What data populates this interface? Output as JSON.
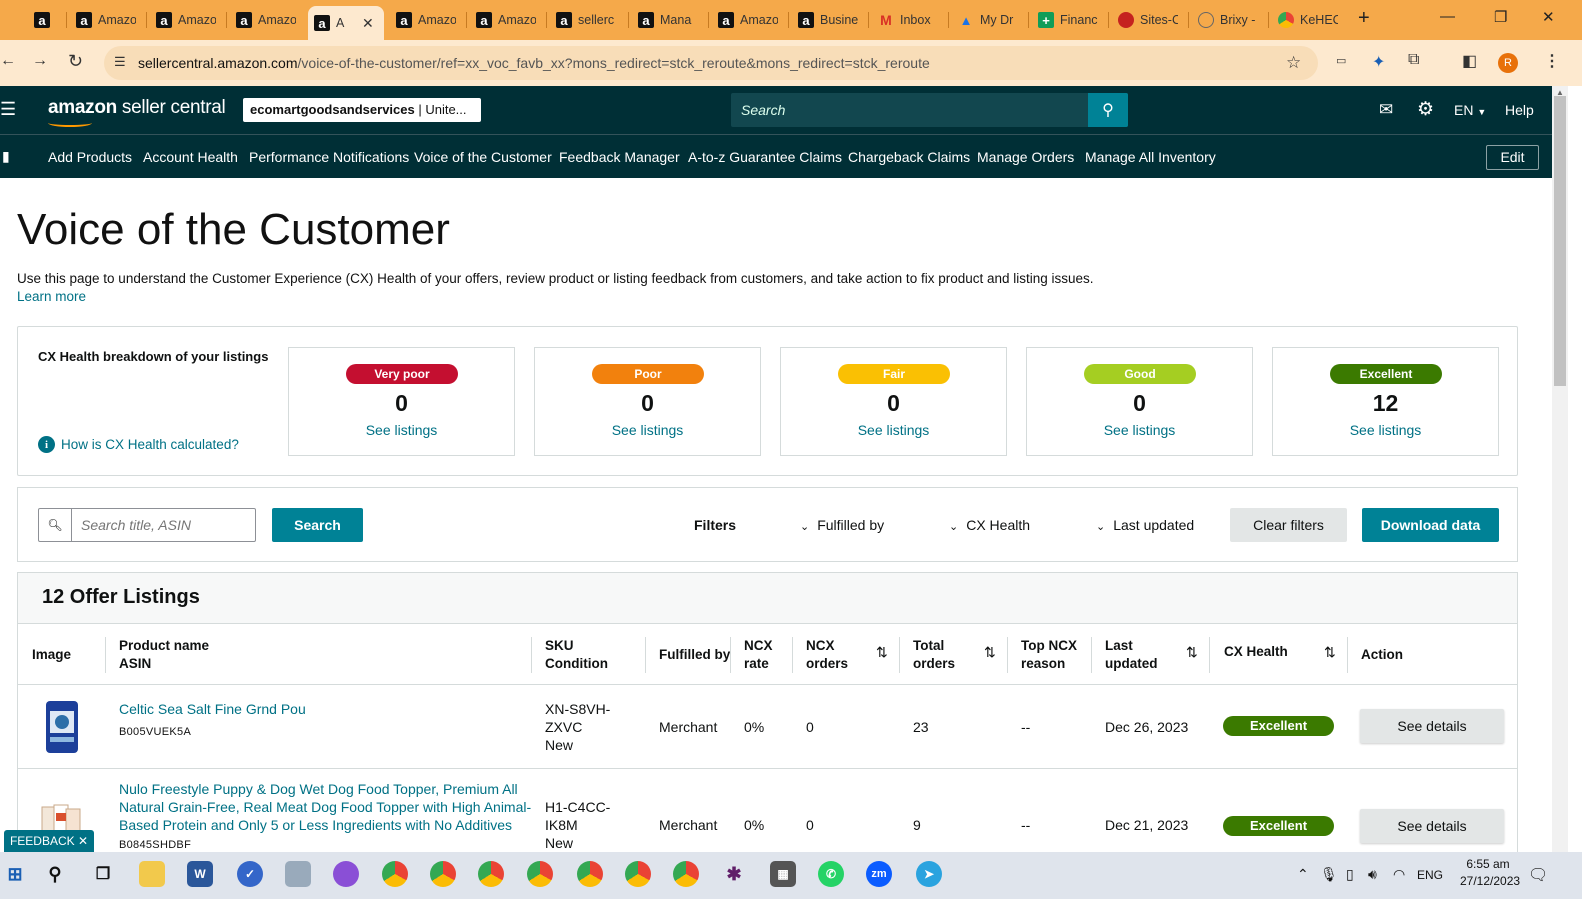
{
  "browser": {
    "tabs": [
      {
        "label": "",
        "icon": "amazon-icon"
      },
      {
        "label": "Amazo",
        "icon": "amazon-icon"
      },
      {
        "label": "Amazo",
        "icon": "amazon-icon"
      },
      {
        "label": "Amazo",
        "icon": "amazon-icon"
      },
      {
        "label": "A",
        "icon": "amazon-icon",
        "active": true
      },
      {
        "label": "Amazo",
        "icon": "amazon-icon"
      },
      {
        "label": "Amazo",
        "icon": "amazon-icon"
      },
      {
        "label": "sellerc",
        "icon": "amazon-icon"
      },
      {
        "label": "Mana",
        "icon": "amazon-icon"
      },
      {
        "label": "Amazo",
        "icon": "amazon-icon"
      },
      {
        "label": "Busine",
        "icon": "amazon-icon"
      },
      {
        "label": "Inbox",
        "icon": "gmail-icon"
      },
      {
        "label": "My Dr",
        "icon": "google-drive-icon"
      },
      {
        "label": "Financ",
        "icon": "google-sheets-icon"
      },
      {
        "label": "Sites-C",
        "icon": "site-icon"
      },
      {
        "label": "Brixy -",
        "icon": "globe-icon"
      },
      {
        "label": "KeHEC",
        "icon": "chrome-icon"
      }
    ],
    "url_domain": "sellercentral.amazon.com",
    "url_path": "/voice-of-the-customer/ref=xx_voc_favb_xx?mons_redirect=stck_reroute&mons_redirect=stck_reroute",
    "profile_initial": "R"
  },
  "header": {
    "logo_bold": "amazon",
    "logo_rest": " seller central",
    "account_bold": "ecomartgoodsandservices",
    "account_rest": " | Unite...",
    "search_placeholder": "Search",
    "language": "EN",
    "help": "Help"
  },
  "nav": {
    "items": [
      "Add Products",
      "Account Health",
      "Performance Notifications",
      "Voice of the Customer",
      "Feedback Manager",
      "A-to-z Guarantee Claims",
      "Chargeback Claims",
      "Manage Orders",
      "Manage All Inventory"
    ],
    "edit": "Edit"
  },
  "page": {
    "title": "Voice of the Customer",
    "intro": "Use this page to understand the Customer Experience (CX) Health of your offers, review product or listing feedback from customers, and take action to fix product and listing issues.",
    "learn_more": "Learn more"
  },
  "cx_health": {
    "title": "CX Health breakdown of your listings",
    "how_link": "How is CX Health calculated?",
    "cards": [
      {
        "label": "Very poor",
        "count": "0",
        "link": "See listings",
        "color": "#c40f30"
      },
      {
        "label": "Poor",
        "count": "0",
        "link": "See listings",
        "color": "#f2810d"
      },
      {
        "label": "Fair",
        "count": "0",
        "link": "See listings",
        "color": "#fac003"
      },
      {
        "label": "Good",
        "count": "0",
        "link": "See listings",
        "color": "#a5ce22"
      },
      {
        "label": "Excellent",
        "count": "12",
        "link": "See listings",
        "color": "#3b7a00"
      }
    ]
  },
  "filters": {
    "search_placeholder": "Search title, ASIN",
    "search_button": "Search",
    "label": "Filters",
    "fulfilled_by": "Fulfilled by",
    "cx_health": "CX Health",
    "last_updated": "Last updated",
    "clear": "Clear filters",
    "download": "Download data"
  },
  "listings": {
    "title": "12 Offer Listings",
    "columns": {
      "image": "Image",
      "product_1": "Product name",
      "product_2": "ASIN",
      "sku_1": "SKU",
      "sku_2": "Condition",
      "fulfilled": "Fulfilled by",
      "ncx_rate_1": "NCX",
      "ncx_rate_2": "rate",
      "ncx_orders_1": "NCX",
      "ncx_orders_2": "orders",
      "total_1": "Total",
      "total_2": "orders",
      "top_1": "Top NCX",
      "top_2": "reason",
      "updated_1": "Last",
      "updated_2": "updated",
      "cx": "CX Health",
      "action": "Action"
    },
    "rows": [
      {
        "name": "Celtic Sea Salt Fine Grnd Pou",
        "asin": "B005VUEK5A",
        "sku_1": "XN-S8VH-",
        "sku_2": "ZXVC",
        "condition": "New",
        "fulfilled": "Merchant",
        "ncx_rate": "0%",
        "ncx_orders": "0",
        "total_orders": "23",
        "top_reason": "--",
        "last_updated": "Dec 26, 2023",
        "cx_health": "Excellent",
        "action": "See details"
      },
      {
        "name_1": "Nulo Freestyle Puppy & Dog Wet Dog Food Topper, Premium All",
        "name_2": "Natural Grain-Free, Real Meat Dog Food Topper with High Animal-",
        "name_3": "Based Protein and Only 5 or Less Ingredients with No Additives",
        "asin": "B0845SHDBF",
        "sku_1": "H1-C4CC-",
        "sku_2": "IK8M",
        "condition": "New",
        "fulfilled": "Merchant",
        "ncx_rate": "0%",
        "ncx_orders": "0",
        "total_orders": "9",
        "top_reason": "--",
        "last_updated": "Dec 21, 2023",
        "cx_health": "Excellent",
        "action": "See details"
      }
    ]
  },
  "feedback": "FEEDBACK",
  "taskbar": {
    "language": "ENG",
    "time": "6:55 am",
    "date": "27/12/2023"
  }
}
